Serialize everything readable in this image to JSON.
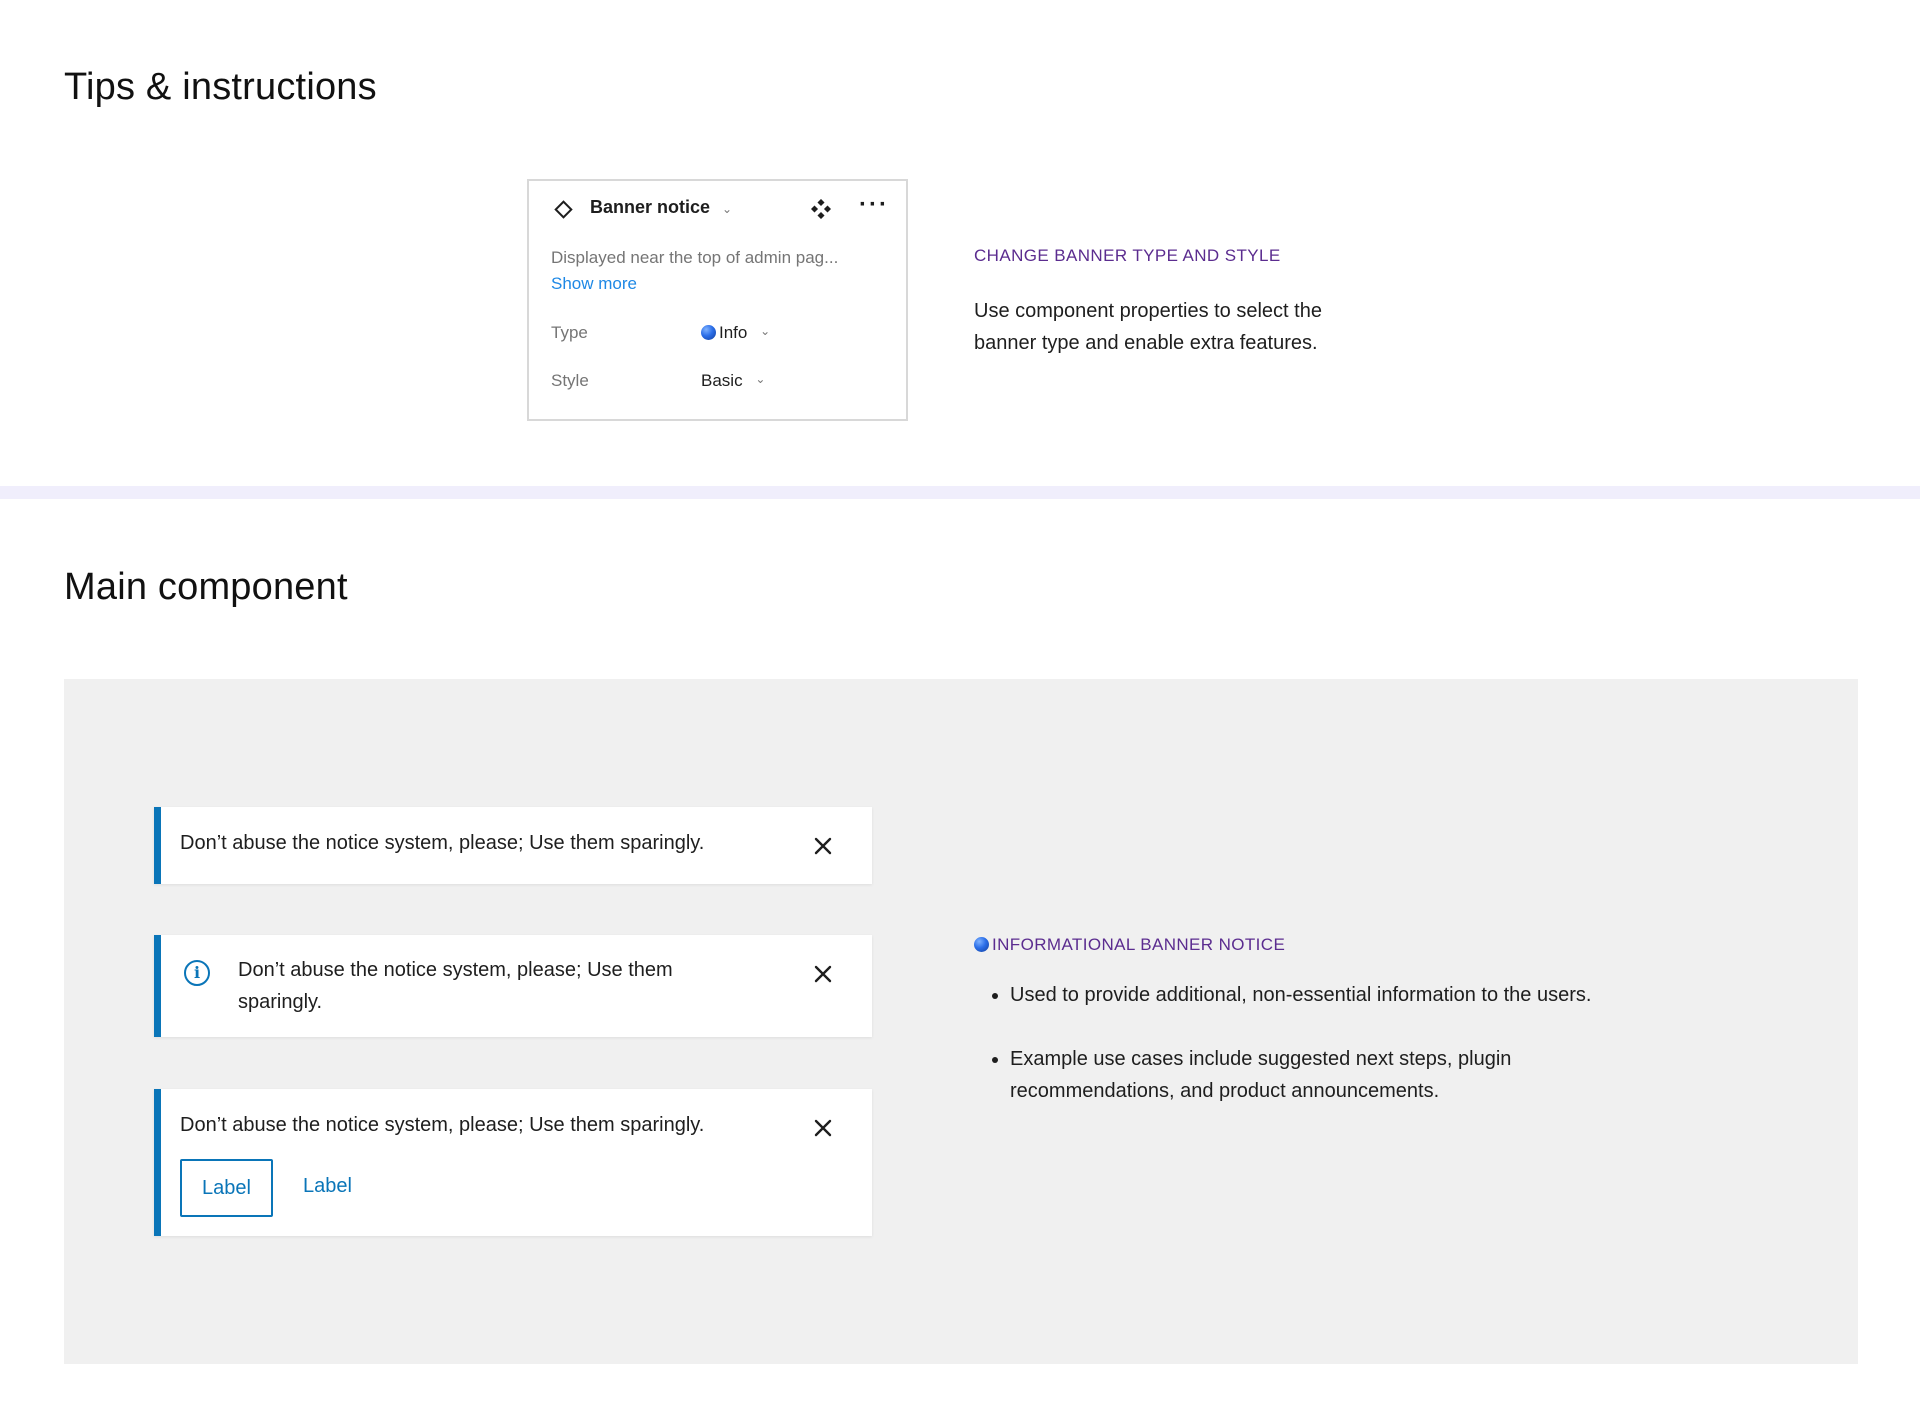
{
  "sections": {
    "tips_title": "Tips & instructions",
    "main_title": "Main component"
  },
  "panel": {
    "component_name": "Banner notice",
    "description": "Displayed near the top of admin pag...",
    "show_more": "Show more",
    "type_label": "Type",
    "type_value": "Info",
    "style_label": "Style",
    "style_value": "Basic",
    "icons": [
      "component-diamond-icon",
      "chevron-down-icon",
      "move-icon",
      "more-options-icon"
    ]
  },
  "tips": {
    "eyebrow": "CHANGE BANNER TYPE AND STYLE",
    "line1": "Use component properties to select the",
    "line2": "banner type and enable extra features."
  },
  "notices": [
    {
      "message": "Don’t abuse the notice system, please; Use them sparingly."
    },
    {
      "message_line1": "Don’t abuse the notice system, please; Use them",
      "message_line2": "sparingly."
    },
    {
      "message": "Don’t abuse the notice system, please; Use them sparingly.",
      "primary_label": "Label",
      "secondary_label": "Label"
    }
  ],
  "info": {
    "eyebrow": "INFORMATIONAL BANNER NOTICE",
    "bullet1": "Used to provide additional, non-essential information to the users.",
    "bullet2_line1": "Example use cases include suggested next steps, plugin",
    "bullet2_line2": "recommendations, and product announcements."
  },
  "colors": {
    "accent_blue": "#0a75b8",
    "link_blue": "#1e88e5",
    "eyebrow_purple": "#5b2c8f",
    "canvas_gray": "#f0f0f0",
    "divider_lavender": "#f0eefc"
  }
}
